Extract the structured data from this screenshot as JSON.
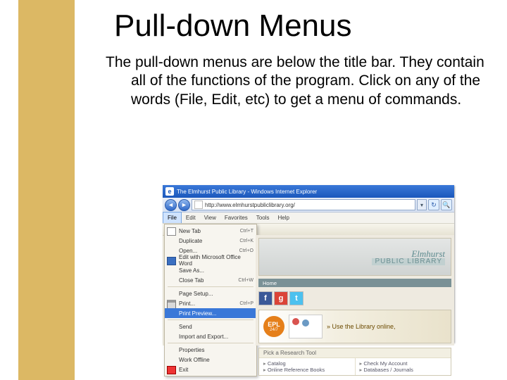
{
  "slide": {
    "title": "Pull-down Menus",
    "description": "The pull-down menus are below the title bar. They contain all of the functions of the program.  Click on any of the words (File, Edit, etc) to get a menu of commands."
  },
  "browser": {
    "window_title": "The Elmhurst Public Library - Windows Internet Explorer",
    "url": "http://www.elmhurstpubliclibrary.org/",
    "menubar": [
      "File",
      "Edit",
      "View",
      "Favorites",
      "Tools",
      "Help"
    ],
    "active_menu_index": 0,
    "file_menu": [
      {
        "label": "New Tab",
        "shortcut": "Ctrl+T",
        "icon": "tab"
      },
      {
        "label": "Duplicate",
        "shortcut": "Ctrl+K"
      },
      {
        "label": "Open...",
        "shortcut": "Ctrl+O"
      },
      {
        "label": "Edit with Microsoft Office Word",
        "icon": "word"
      },
      {
        "label": "Save As..."
      },
      {
        "label": "Close Tab",
        "shortcut": "Ctrl+W"
      },
      {
        "sep": true
      },
      {
        "label": "Page Setup..."
      },
      {
        "label": "Print...",
        "shortcut": "Ctrl+P",
        "icon": "printer"
      },
      {
        "label": "Print Preview...",
        "highlight": true
      },
      {
        "sep": true
      },
      {
        "label": "Send"
      },
      {
        "label": "Import and Export..."
      },
      {
        "sep": true
      },
      {
        "label": "Properties"
      },
      {
        "label": "Work Offline"
      },
      {
        "label": "Exit",
        "icon": "exit"
      }
    ]
  },
  "page": {
    "logo_line1": "Elmhurst",
    "logo_line2": "PUBLIC LIBRARY",
    "nav_home": "Home",
    "promo_badge_top": "EPL",
    "promo_badge_bottom": "24/7",
    "promo_text": "» Use the Library online,",
    "research_heading": "Pick a Research Tool",
    "research_col1": [
      "Catalog",
      "Online Reference Books"
    ],
    "research_col2": [
      "Check My Account",
      "Databases / Journals"
    ]
  }
}
